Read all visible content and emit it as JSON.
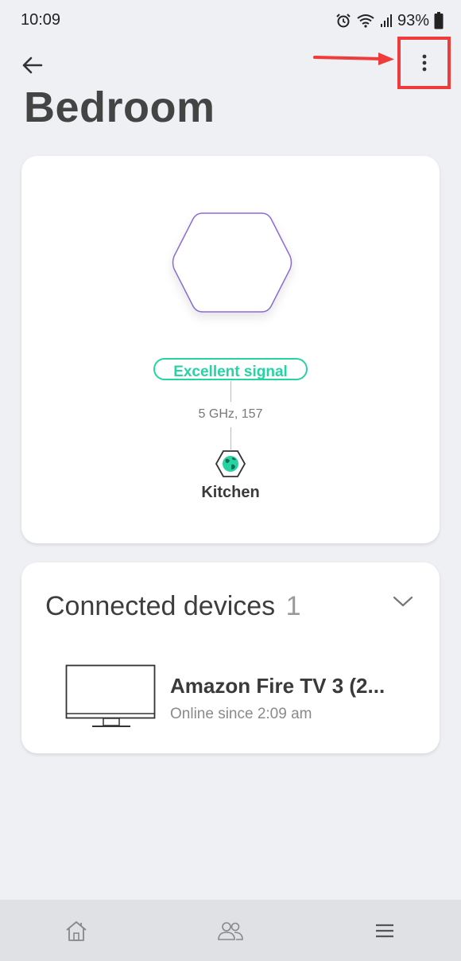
{
  "status_bar": {
    "time": "10:09",
    "battery": "93%",
    "icons": [
      "alarm-icon",
      "wifi-icon",
      "signal-icon",
      "battery-icon"
    ]
  },
  "header": {
    "back_icon": "arrow-left-icon",
    "more_icon": "more-vertical-icon",
    "title": "Bedroom"
  },
  "node": {
    "signal": "Excellent signal",
    "band": "5 GHz, 157",
    "parent": "Kitchen",
    "icon": "hexagon-node-icon",
    "parent_icon": "globe-hex-icon"
  },
  "devices": {
    "title": "Connected devices",
    "count": "1",
    "items": [
      {
        "name": "Amazon Fire TV 3 (2...",
        "status": "Online since 2:09 am",
        "icon": "tv-icon"
      }
    ]
  },
  "bottom_nav": {
    "items": [
      "home-icon",
      "people-icon",
      "menu-icon"
    ]
  },
  "colors": {
    "accent_green": "#26d3a2",
    "node_purple": "#8a6ad8",
    "annotation_red": "#ee3b3b",
    "background": "#eef0f3"
  }
}
